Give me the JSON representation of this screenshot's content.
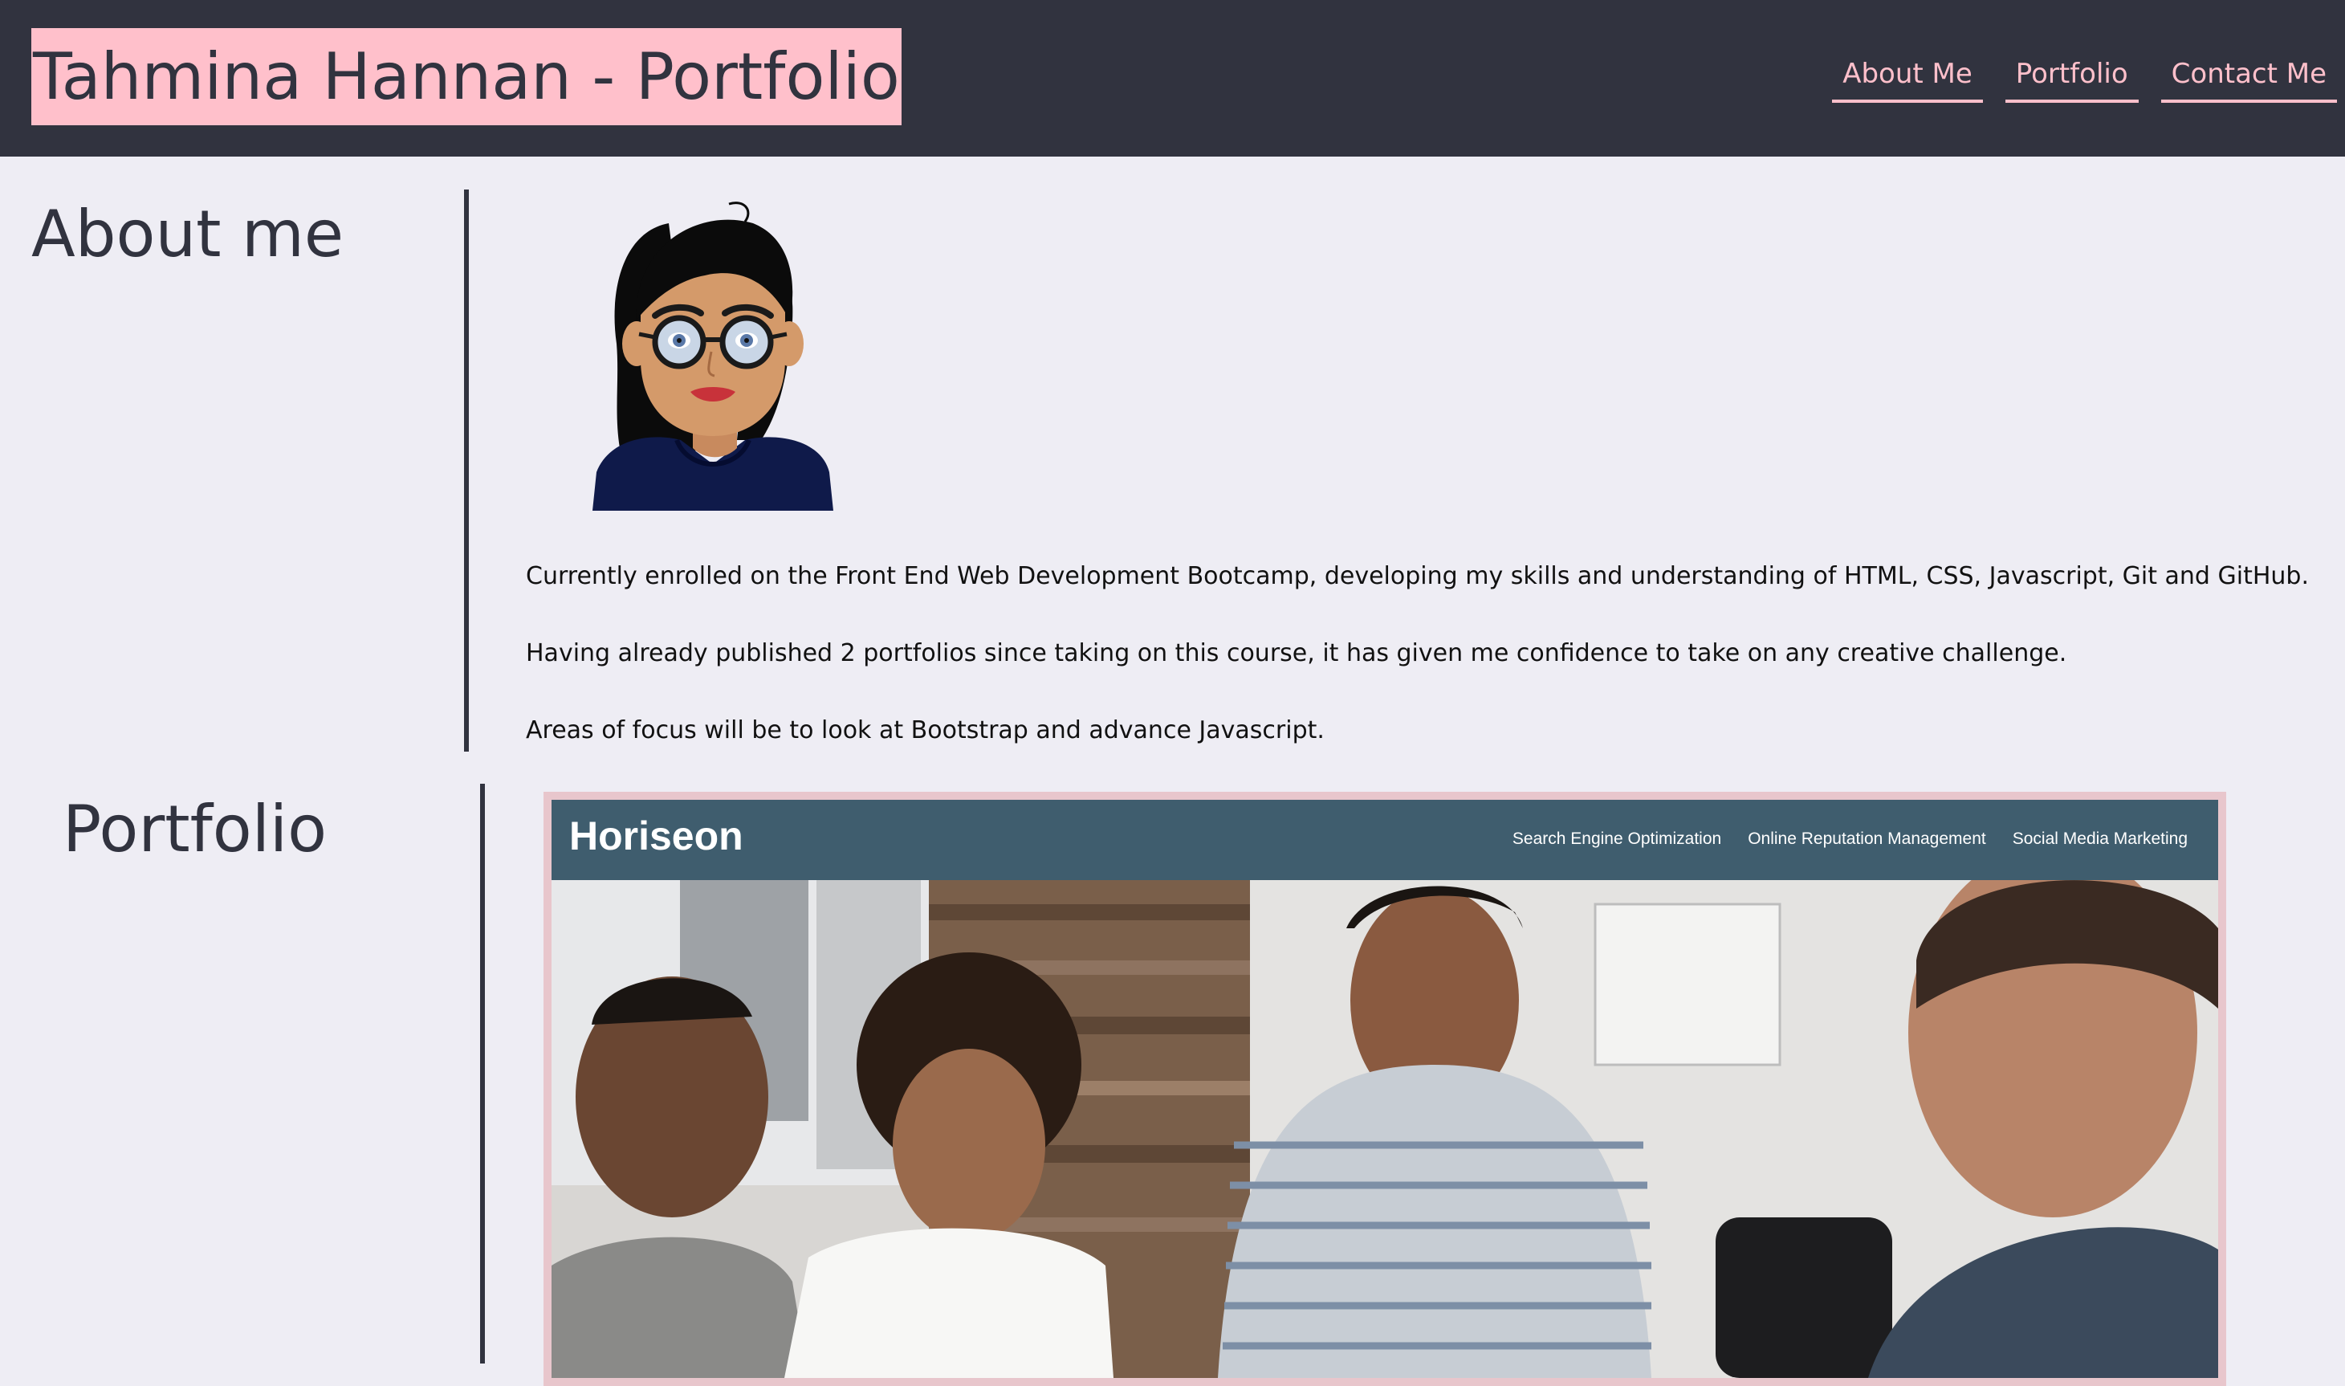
{
  "header": {
    "title": "Tahmina Hannan - Portfolio",
    "nav": [
      {
        "label": "About Me"
      },
      {
        "label": "Portfolio"
      },
      {
        "label": "Contact Me"
      }
    ]
  },
  "about": {
    "heading": "About me",
    "avatar_icon": "cartoon-woman-avatar",
    "paragraphs": [
      "Currently enrolled on the Front End Web Development Bootcamp, developing my skills and understanding of HTML, CSS, Javascript, Git and GitHub.",
      "Having already published 2 portfolios since taking on this course, it has given me confidence to take on any creative challenge.",
      "Areas of focus will be to look at Bootstrap and advance Javascript."
    ]
  },
  "portfolio": {
    "heading": "Portfolio",
    "project": {
      "brand": "Horiseon",
      "nav": [
        "Search Engine Optimization",
        "Online Reputation Management",
        "Social Media Marketing"
      ]
    }
  },
  "colors": {
    "header_bg": "#31333f",
    "accent_pink": "#ffc0cb",
    "page_bg": "#eeedf4",
    "project_header_bg": "#3f5d6e"
  }
}
